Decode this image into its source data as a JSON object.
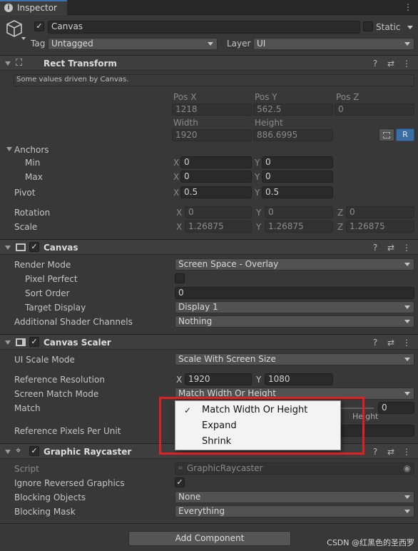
{
  "tab": {
    "title": "Inspector"
  },
  "object": {
    "name": "Canvas",
    "static_label": "Static",
    "tag_label": "Tag",
    "tag_value": "Untagged",
    "layer_label": "Layer",
    "layer_value": "UI"
  },
  "rect_transform": {
    "title": "Rect Transform",
    "info": "Some values driven by Canvas.",
    "pos_x_label": "Pos X",
    "pos_y_label": "Pos Y",
    "pos_z_label": "Pos Z",
    "pos_x": "1218",
    "pos_y": "562.5",
    "pos_z": "0",
    "width_label": "Width",
    "height_label": "Height",
    "width": "1920",
    "height": "886.6995",
    "r_button": "R",
    "anchors_label": "Anchors",
    "min_label": "Min",
    "max_label": "Max",
    "min_x": "0",
    "min_y": "0",
    "max_x": "0",
    "max_y": "0",
    "pivot_label": "Pivot",
    "pivot_x": "0.5",
    "pivot_y": "0.5",
    "rotation_label": "Rotation",
    "rot_x": "0",
    "rot_y": "0",
    "rot_z": "0",
    "scale_label": "Scale",
    "scale_x": "1.26875",
    "scale_y": "1.26875",
    "scale_z": "1.26875"
  },
  "axes": {
    "x": "X",
    "y": "Y",
    "z": "Z"
  },
  "canvas": {
    "title": "Canvas",
    "render_mode_label": "Render Mode",
    "render_mode": "Screen Space - Overlay",
    "pixel_perfect_label": "Pixel Perfect",
    "sort_order_label": "Sort Order",
    "sort_order": "0",
    "target_display_label": "Target Display",
    "target_display": "Display 1",
    "shader_channels_label": "Additional Shader Channels",
    "shader_channels": "Nothing"
  },
  "scaler": {
    "title": "Canvas Scaler",
    "ui_scale_mode_label": "UI Scale Mode",
    "ui_scale_mode": "Scale With Screen Size",
    "ref_res_label": "Reference Resolution",
    "ref_x": "1920",
    "ref_y": "1080",
    "match_mode_label": "Screen Match Mode",
    "match_mode": "Match Width Or Height",
    "match_label": "Match",
    "match_value": "0",
    "height_label": "Height",
    "ppu_label": "Reference Pixels Per Unit"
  },
  "raycaster": {
    "title": "Graphic Raycaster",
    "script_label": "Script",
    "script_value": "GraphicRaycaster",
    "ignore_reversed_label": "Ignore Reversed Graphics",
    "blocking_objects_label": "Blocking Objects",
    "blocking_objects": "None",
    "blocking_mask_label": "Blocking Mask",
    "blocking_mask": "Everything"
  },
  "popup": {
    "items": [
      "Match Width Or Height",
      "Expand",
      "Shrink"
    ],
    "selected_index": 0,
    "check": "✓"
  },
  "add_component": "Add Component",
  "watermark": "CSDN @红黑色的圣西罗",
  "colors": {
    "highlight_box": "#e02020",
    "accent": "#3a72b0",
    "background": "#383838"
  }
}
